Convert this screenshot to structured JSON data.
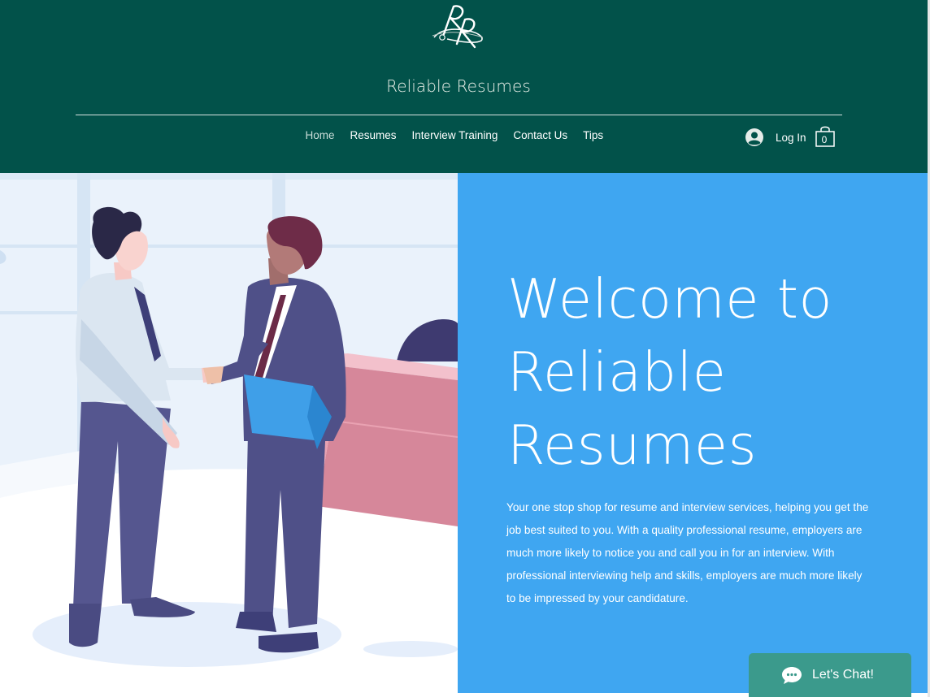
{
  "brand": {
    "logo_text": "RR",
    "site_title": "Reliable Resumes"
  },
  "nav": {
    "items": [
      {
        "label": "Home"
      },
      {
        "label": "Resumes"
      },
      {
        "label": "Interview Training"
      },
      {
        "label": "Contact Us"
      },
      {
        "label": "Tips"
      }
    ],
    "login_label": "Log In",
    "cart_count": "0"
  },
  "hero": {
    "title_lines": [
      "Welcome to",
      "Reliable",
      "Resumes"
    ],
    "body": "Your one stop shop for resume and interview services, helping you get the job best suited to you. With a quality professional resume, employers are much more likely to notice you and call you in for an interview. With professional interviewing help and skills, employers are much more likely to be impressed by your candidature."
  },
  "chat": {
    "label": "Let's Chat!"
  },
  "colors": {
    "header_bg": "#02524a",
    "hero_blue": "#3fa6f1",
    "chat_bg": "#3b9a8c"
  },
  "icons": [
    "logo-mark",
    "avatar-icon",
    "cart-icon",
    "chat-bubble-icon"
  ]
}
